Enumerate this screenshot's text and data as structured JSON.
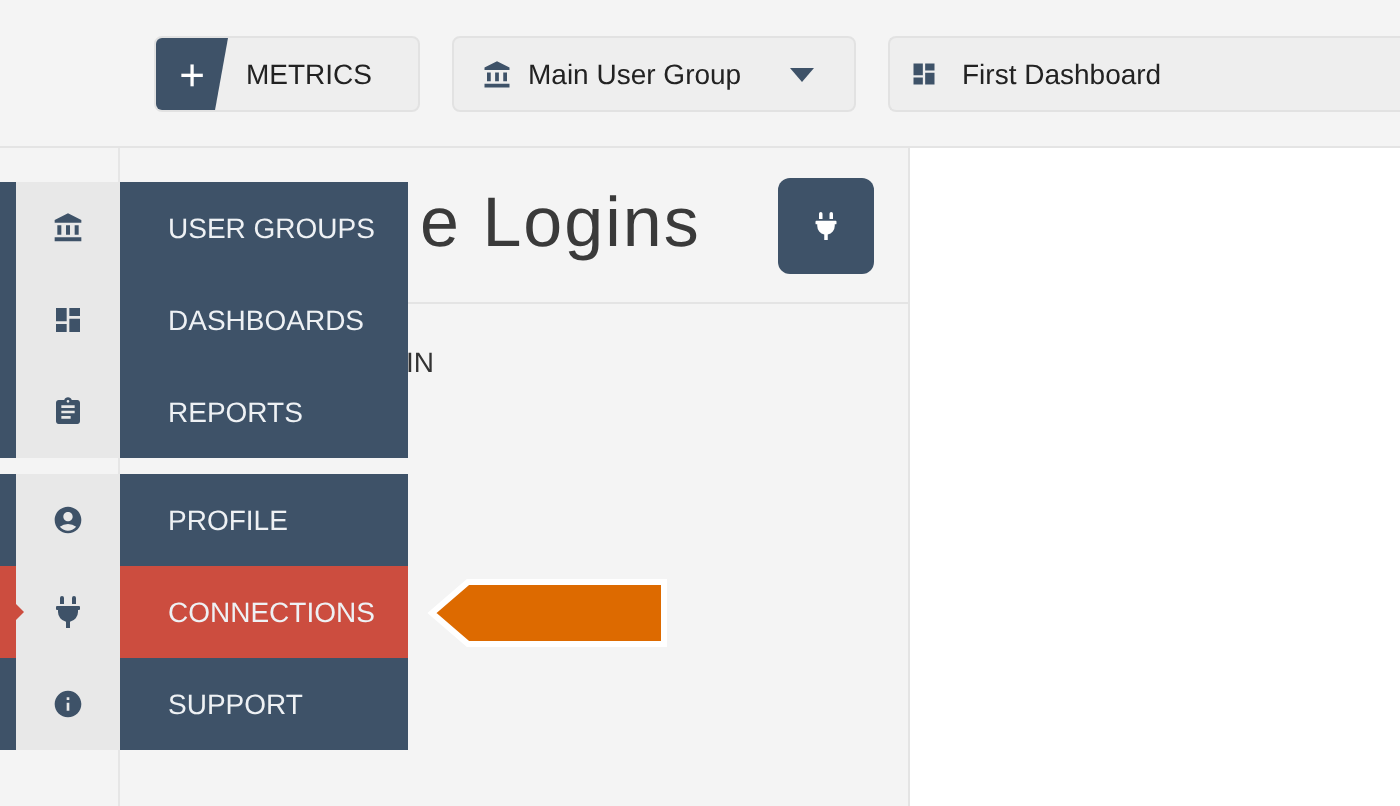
{
  "toolbar": {
    "add_button": {
      "symbol": "+",
      "label": "METRICS"
    },
    "group_select": {
      "value": "Main User Group"
    },
    "dashboard_select": {
      "value": "First Dashboard"
    }
  },
  "menu": {
    "groups": [
      {
        "items": [
          {
            "kind": "bank",
            "label": "USER GROUPS",
            "selected": false
          },
          {
            "kind": "dashboard",
            "label": "DASHBOARDS",
            "selected": false
          },
          {
            "kind": "clipboard",
            "label": "REPORTS",
            "selected": false
          }
        ]
      },
      {
        "items": [
          {
            "kind": "profile",
            "label": "PROFILE",
            "selected": false
          },
          {
            "kind": "plug",
            "label": "CONNECTIONS",
            "selected": true
          },
          {
            "kind": "info",
            "label": "SUPPORT",
            "selected": false
          }
        ]
      }
    ]
  },
  "page": {
    "title": "e Logins",
    "label": "IN"
  }
}
